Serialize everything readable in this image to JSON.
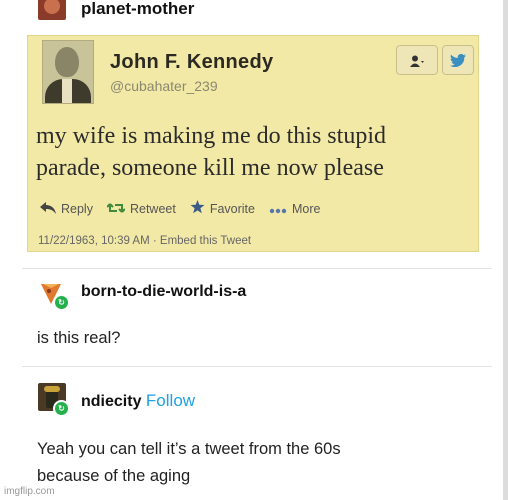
{
  "post": {
    "username": "planet-mother"
  },
  "tweet": {
    "name": "John F. Kennedy",
    "handle": "@cubahater_239",
    "text_line1": "my wife is making me do this stupid",
    "text_line2": "parade, someone kill me now please",
    "actions": {
      "reply": "Reply",
      "retweet": "Retweet",
      "favorite": "Favorite",
      "more": "More"
    },
    "timestamp": "11/22/1963, 10:39 AM · Embed this Tweet",
    "icons": [
      "person-icon",
      "twitter-bird-icon",
      "reply-arrow-icon",
      "retweet-icon",
      "star-icon",
      "more-dots-icon"
    ]
  },
  "reply1": {
    "username": "born-to-die-world-is-a",
    "text": "is this real?"
  },
  "reply2": {
    "username": "ndiecity",
    "follow_label": "Follow",
    "text_line1": "Yeah you can tell it’s a tweet from the 60s",
    "text_line2": "because of the aging"
  },
  "watermark": "imgflip.com",
  "colors": {
    "tweet_bg": "#f3e9a6",
    "follow_blue": "#1ea1e8",
    "reblog_badge": "#24b14c"
  }
}
